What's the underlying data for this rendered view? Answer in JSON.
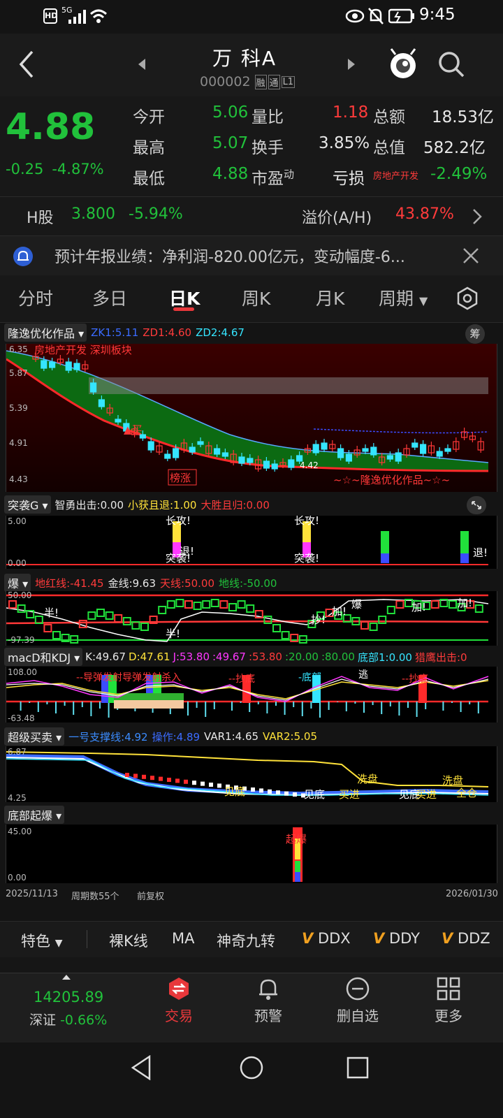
{
  "status": {
    "network": "5G",
    "time": "9:45"
  },
  "header": {
    "title": "万 科A",
    "code": "000002",
    "badges": [
      "融",
      "通",
      "L1"
    ]
  },
  "quote": {
    "price": "4.88",
    "change": "-0.25",
    "change_pct": "-4.87%",
    "rows": [
      {
        "l1": "今开",
        "v1": "5.06",
        "l2": "量比",
        "v2": "1.18",
        "l3": "总额",
        "v3": "18.53亿"
      },
      {
        "l1": "最高",
        "v1": "5.07",
        "l2": "换手",
        "v2": "3.85%",
        "l3": "总值",
        "v3": "582.2亿"
      },
      {
        "l1": "最低",
        "v1": "4.88",
        "l2": "市盈",
        "v2": "亏损",
        "l3": "房地产开发",
        "v3": "-2.49%"
      }
    ],
    "pe_sup": "动"
  },
  "hshare": {
    "label": "H股",
    "price": "3.800",
    "pct": "-5.94%",
    "prem_label": "溢价(A/H)",
    "prem": "43.87%"
  },
  "notice": {
    "text": "预计年报业绩：净利润-820.00亿元，变动幅度-6..."
  },
  "tabs": [
    "分时",
    "多日",
    "日K",
    "周K",
    "月K",
    "周期"
  ],
  "main_indicator": {
    "name": "隆逸优化作品",
    "zk1": "ZK1:5.11",
    "zd1": "ZD1:4.60",
    "zd2": "ZD2:4.67",
    "chip": "筹",
    "overlay": "房地产开发 深圳板块",
    "y_labels": [
      "6.35",
      "5.87",
      "5.39",
      "4.91",
      "4.43"
    ],
    "buy": "▲买",
    "rank": "榜涨",
    "tag": "~☆~隆逸优化作品~☆~",
    "low_tag": "4.42"
  },
  "ind1": {
    "name": "突袭G",
    "a": "智勇出击:0.00",
    "b": "小获且退:1.00",
    "c": "大胜且归:0.00",
    "y_top": "5.00",
    "y_bot": "0.00",
    "marks": [
      "长攻!",
      "突袭!",
      "退!",
      "长攻!",
      "突袭!",
      "退!"
    ]
  },
  "ind2": {
    "name": "爆",
    "a": "地红线:-41.45",
    "b": "金线:9.63",
    "c": "天线:50.00",
    "d": "地线:-50.00",
    "y_top": "50.00",
    "y_bot": "-97.39",
    "marks": [
      "半!",
      "半!",
      "抄!",
      "加!",
      "爆",
      "加!",
      "加!"
    ]
  },
  "ind3": {
    "name": "macD和KDJ",
    "k": "K:49.67",
    "d": "D:47.61",
    "j": "J:53.80",
    "v1": ":49.67",
    "v2": ":53.80",
    "v3": ":20.00",
    "v4": ":80.00",
    "bottom": "底部1:0.00",
    "hunt": "猎鹰出击:0",
    "y_top": "108.00",
    "y_bot": "-63.48",
    "marks": [
      "--导弹发射导弹发射杀入",
      "--抄底",
      "-底部",
      "逃",
      "--抄底"
    ]
  },
  "ind4": {
    "name": "超级买卖",
    "a": "一号支撑线:4.92",
    "b": "操作:4.89",
    "c": "VAR1:4.65",
    "d": "VAR2:5.05",
    "y_top": "6.87",
    "y_bot": "4.25",
    "marks": [
      "见底",
      "见底",
      "买进",
      "洗盘",
      "见底",
      "买进",
      "洗盘",
      "全仓"
    ]
  },
  "ind5": {
    "name": "底部起爆",
    "y_top": "45.00",
    "y_bot": "0.00",
    "mark": "起爆"
  },
  "dates": {
    "start": "2025/11/13",
    "count": "周期数55个",
    "adj": "前复权",
    "end": "2026/01/30"
  },
  "features": {
    "first": "特色",
    "items": [
      "裸K线",
      "MA",
      "神奇九转",
      "DDX",
      "DDY",
      "DDZ"
    ]
  },
  "bottom": {
    "index_val": "14205.89",
    "index_name": "深证",
    "index_pct": "-0.66%",
    "nav": [
      "交易",
      "预警",
      "删自选",
      "更多"
    ]
  },
  "colors": {
    "up": "#ff3b3b",
    "down": "#21c13b",
    "accent": "#e8383b"
  }
}
